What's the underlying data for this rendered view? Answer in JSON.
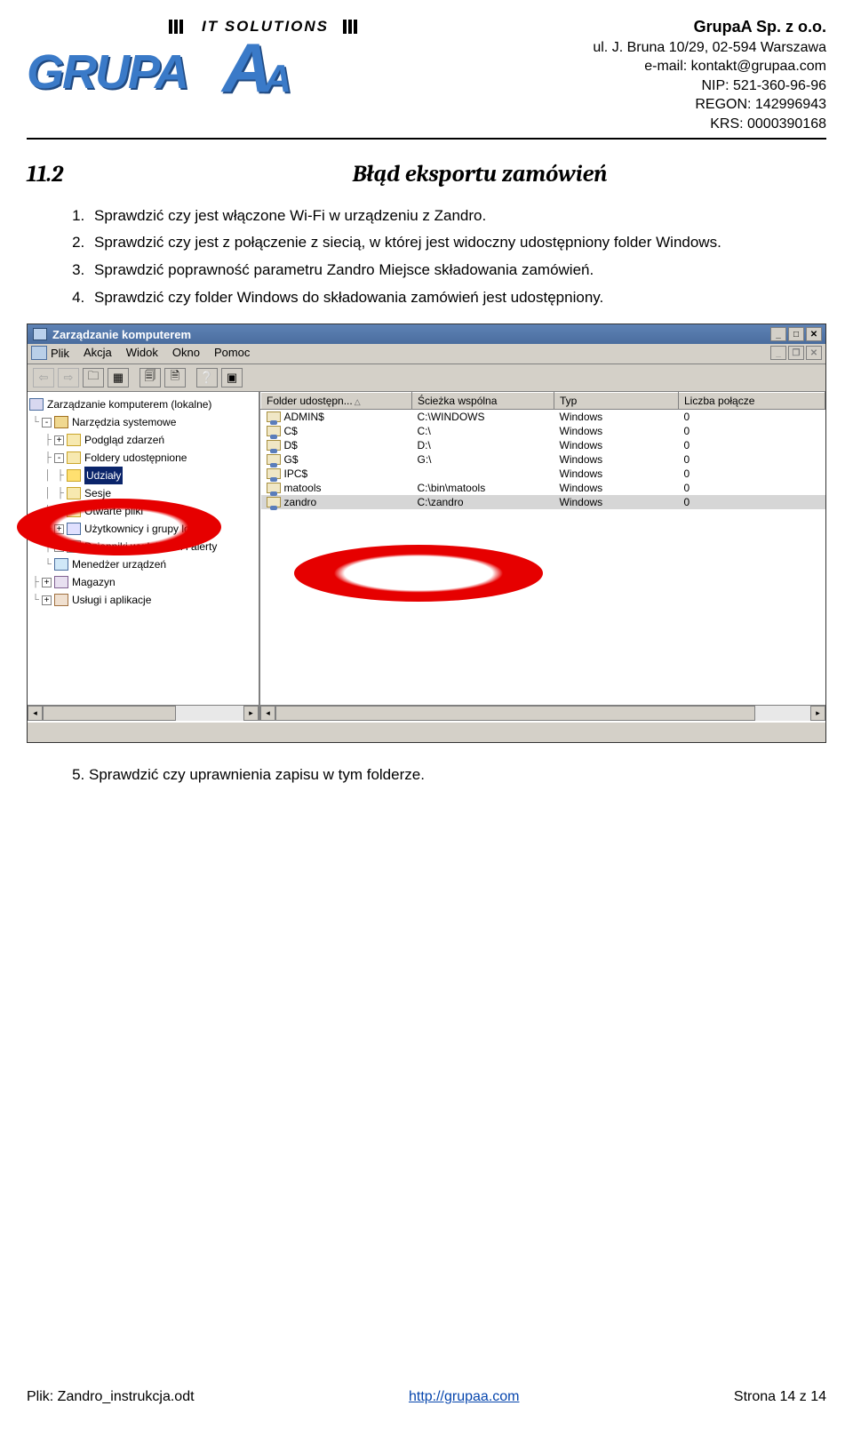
{
  "company": {
    "name": "GrupaA Sp. z o.o.",
    "address": "ul. J. Bruna 10/29, 02-594 Warszawa",
    "email": "e-mail: kontakt@grupaa.com",
    "nip": "NIP: 521-360-96-96",
    "regon": "REGON: 142996943",
    "krs": "KRS: 0000390168"
  },
  "logo": {
    "it": "IT SOLUTIONS",
    "grupa": "GRUPA"
  },
  "section": {
    "number": "11.2",
    "title": "Błąd eksportu zamówień"
  },
  "steps": [
    "Sprawdzić czy jest włączone Wi-Fi w urządzeniu z Zandro.",
    "Sprawdzić czy jest z połączenie z siecią, w której jest widoczny udostępniony folder Windows.",
    "Sprawdzić poprawność parametru Zandro Miejsce składowania zamówień.",
    "Sprawdzić czy folder Windows do składowania zamówień jest udostępniony."
  ],
  "step5": "Sprawdzić czy uprawnienia zapisu w tym folderze.",
  "screenshot": {
    "title": "Zarządzanie komputerem",
    "menus": [
      "Plik",
      "Akcja",
      "Widok",
      "Okno",
      "Pomoc"
    ],
    "tree": {
      "root": "Zarządzanie komputerem (lokalne)",
      "tools": "Narzędzia systemowe",
      "event": "Podgląd zdarzeń",
      "shared": "Foldery udostępnione",
      "shares": "Udziały",
      "sessions": "Sesje",
      "openfiles": "Otwarte pliki",
      "users": "Użytkownicy i grupy lokalne",
      "logs": "Dzienniki wydajności i alerty",
      "devmgr": "Menedżer urządzeń",
      "storage": "Magazyn",
      "services": "Usługi i aplikacje"
    },
    "columns": {
      "c1": "Folder udostępn...",
      "c2": "Ścieżka wspólna",
      "c3": "Typ",
      "c4": "Liczba połącze"
    },
    "rows": [
      {
        "name": "ADMIN$",
        "path": "C:\\WINDOWS",
        "type": "Windows",
        "conn": "0"
      },
      {
        "name": "C$",
        "path": "C:\\",
        "type": "Windows",
        "conn": "0"
      },
      {
        "name": "D$",
        "path": "D:\\",
        "type": "Windows",
        "conn": "0"
      },
      {
        "name": "G$",
        "path": "G:\\",
        "type": "Windows",
        "conn": "0"
      },
      {
        "name": "IPC$",
        "path": "",
        "type": "Windows",
        "conn": "0"
      },
      {
        "name": "matools",
        "path": "C:\\bin\\matools",
        "type": "Windows",
        "conn": "0"
      },
      {
        "name": "zandro",
        "path": "C:\\zandro",
        "type": "Windows",
        "conn": "0"
      }
    ]
  },
  "footer": {
    "file": "Plik: Zandro_instrukcja.odt",
    "url": "http://grupaa.com",
    "page": "Strona 14 z 14"
  }
}
